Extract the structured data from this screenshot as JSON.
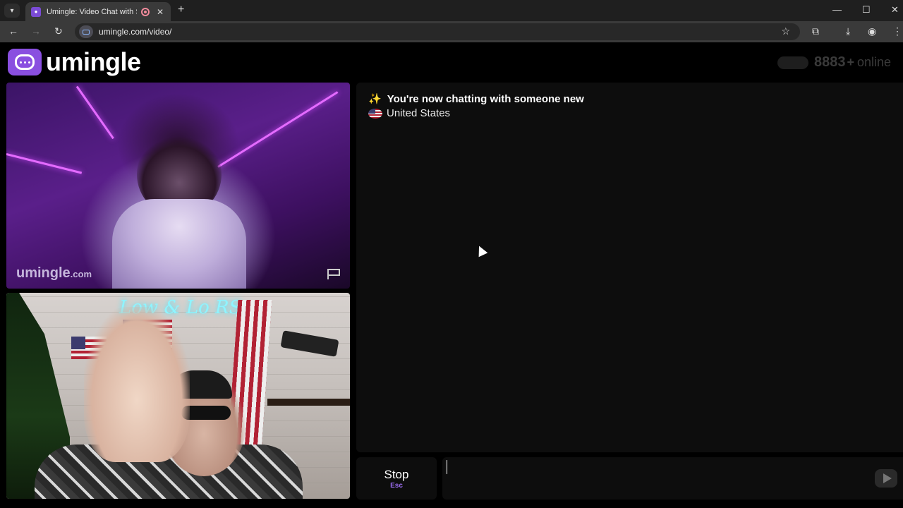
{
  "browser": {
    "tab_title": "Umingle: Video Chat with S",
    "tab_close": "✕",
    "new_tab": "+",
    "url": "umingle.com/video/",
    "window": {
      "minimize": "—",
      "maximize": "☐",
      "close": "✕"
    }
  },
  "header": {
    "logo_text": "umingle",
    "online_count": "8883",
    "online_plus": "+",
    "online_label": "online"
  },
  "remote_video": {
    "watermark_main": "umingle",
    "watermark_suffix": ".com"
  },
  "local_video": {
    "neon_sign": "Low & Lo RS"
  },
  "chat": {
    "status_emoji": "✨",
    "status_text": "You're now chatting with someone new",
    "country": "United States"
  },
  "controls": {
    "stop_label": "Stop",
    "stop_key": "Esc",
    "message_value": ""
  }
}
